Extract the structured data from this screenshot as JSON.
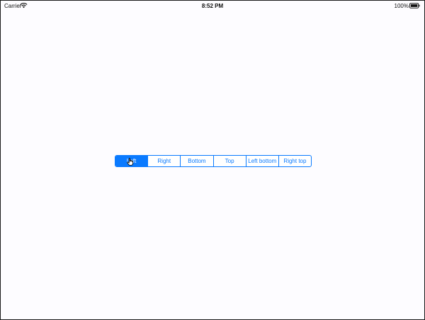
{
  "status_bar": {
    "carrier": "Carrier",
    "time": "8:52 PM",
    "battery": "100%",
    "icons": [
      "wifi-icon",
      "battery-icon"
    ]
  },
  "segmented_control": {
    "selected_index": 0,
    "segments": [
      {
        "label": "Left"
      },
      {
        "label": "Right"
      },
      {
        "label": "Bottom"
      },
      {
        "label": "Top"
      },
      {
        "label": "Left bottom"
      },
      {
        "label": "Right top"
      }
    ]
  },
  "colors": {
    "accent": "#0a7aff",
    "background": "#fdfcff",
    "frame": "#1a1a1a"
  },
  "pointer": {
    "icon": "hand-pointer-icon"
  }
}
